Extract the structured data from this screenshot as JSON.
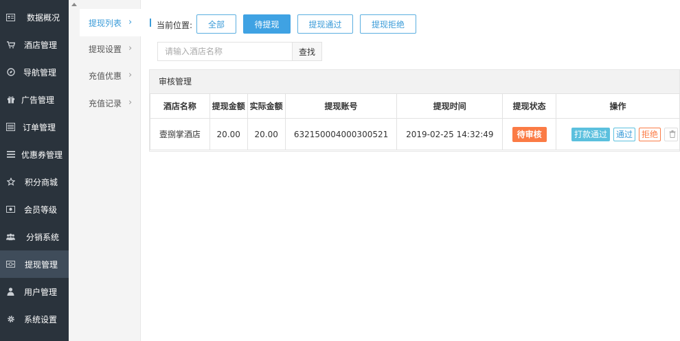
{
  "sidebar": {
    "items": [
      {
        "label": "数据概况",
        "icon": "dashboard-icon",
        "active": false
      },
      {
        "label": "酒店管理",
        "icon": "cart-icon",
        "active": false
      },
      {
        "label": "导航管理",
        "icon": "compass-icon",
        "active": false
      },
      {
        "label": "广告管理",
        "icon": "gift-icon",
        "active": false
      },
      {
        "label": "订单管理",
        "icon": "server-icon",
        "active": false
      },
      {
        "label": "优惠券管理",
        "icon": "menu-icon",
        "active": false
      },
      {
        "label": "积分商城",
        "icon": "star-icon",
        "active": false
      },
      {
        "label": "会员等级",
        "icon": "card-icon",
        "active": false
      },
      {
        "label": "分销系统",
        "icon": "users-icon",
        "active": false
      },
      {
        "label": "提现管理",
        "icon": "money-icon",
        "active": true
      },
      {
        "label": "用户管理",
        "icon": "user-icon",
        "active": false
      },
      {
        "label": "系统设置",
        "icon": "gear-icon",
        "active": false
      }
    ]
  },
  "submenu": {
    "items": [
      {
        "label": "提现列表",
        "active": true
      },
      {
        "label": "提现设置",
        "active": false
      },
      {
        "label": "充值优惠",
        "active": false
      },
      {
        "label": "充值记录",
        "active": false
      }
    ],
    "arrow": "›"
  },
  "location": {
    "label": "当前位置:",
    "tabs": [
      {
        "label": "全部",
        "active": false
      },
      {
        "label": "待提现",
        "active": true
      },
      {
        "label": "提现通过",
        "active": false
      },
      {
        "label": "提现拒绝",
        "active": false
      }
    ]
  },
  "search": {
    "placeholder": "请输入酒店名称",
    "value": "",
    "button_label": "查找"
  },
  "panel": {
    "title": "审核管理"
  },
  "table": {
    "headers": [
      "酒店名称",
      "提现金额",
      "实际金额",
      "提现账号",
      "提现时间",
      "提现状态",
      "操作"
    ],
    "rows": [
      {
        "hotel": "壹捌掌酒店",
        "amount": "20.00",
        "actual": "20.00",
        "account": "632150004000300521",
        "time": "2019-02-25 14:32:49",
        "status": "待审核",
        "actions": {
          "pay": "打款通过",
          "pass": "通过",
          "reject": "拒绝",
          "delete_icon": "trash-icon"
        }
      }
    ]
  },
  "colors": {
    "sidebar_bg": "#2a333c",
    "sidebar_active": "#3f4c5a",
    "accent": "#3fa2e3",
    "status_orange": "#fb7b45",
    "pay_button": "#5bc0de"
  }
}
